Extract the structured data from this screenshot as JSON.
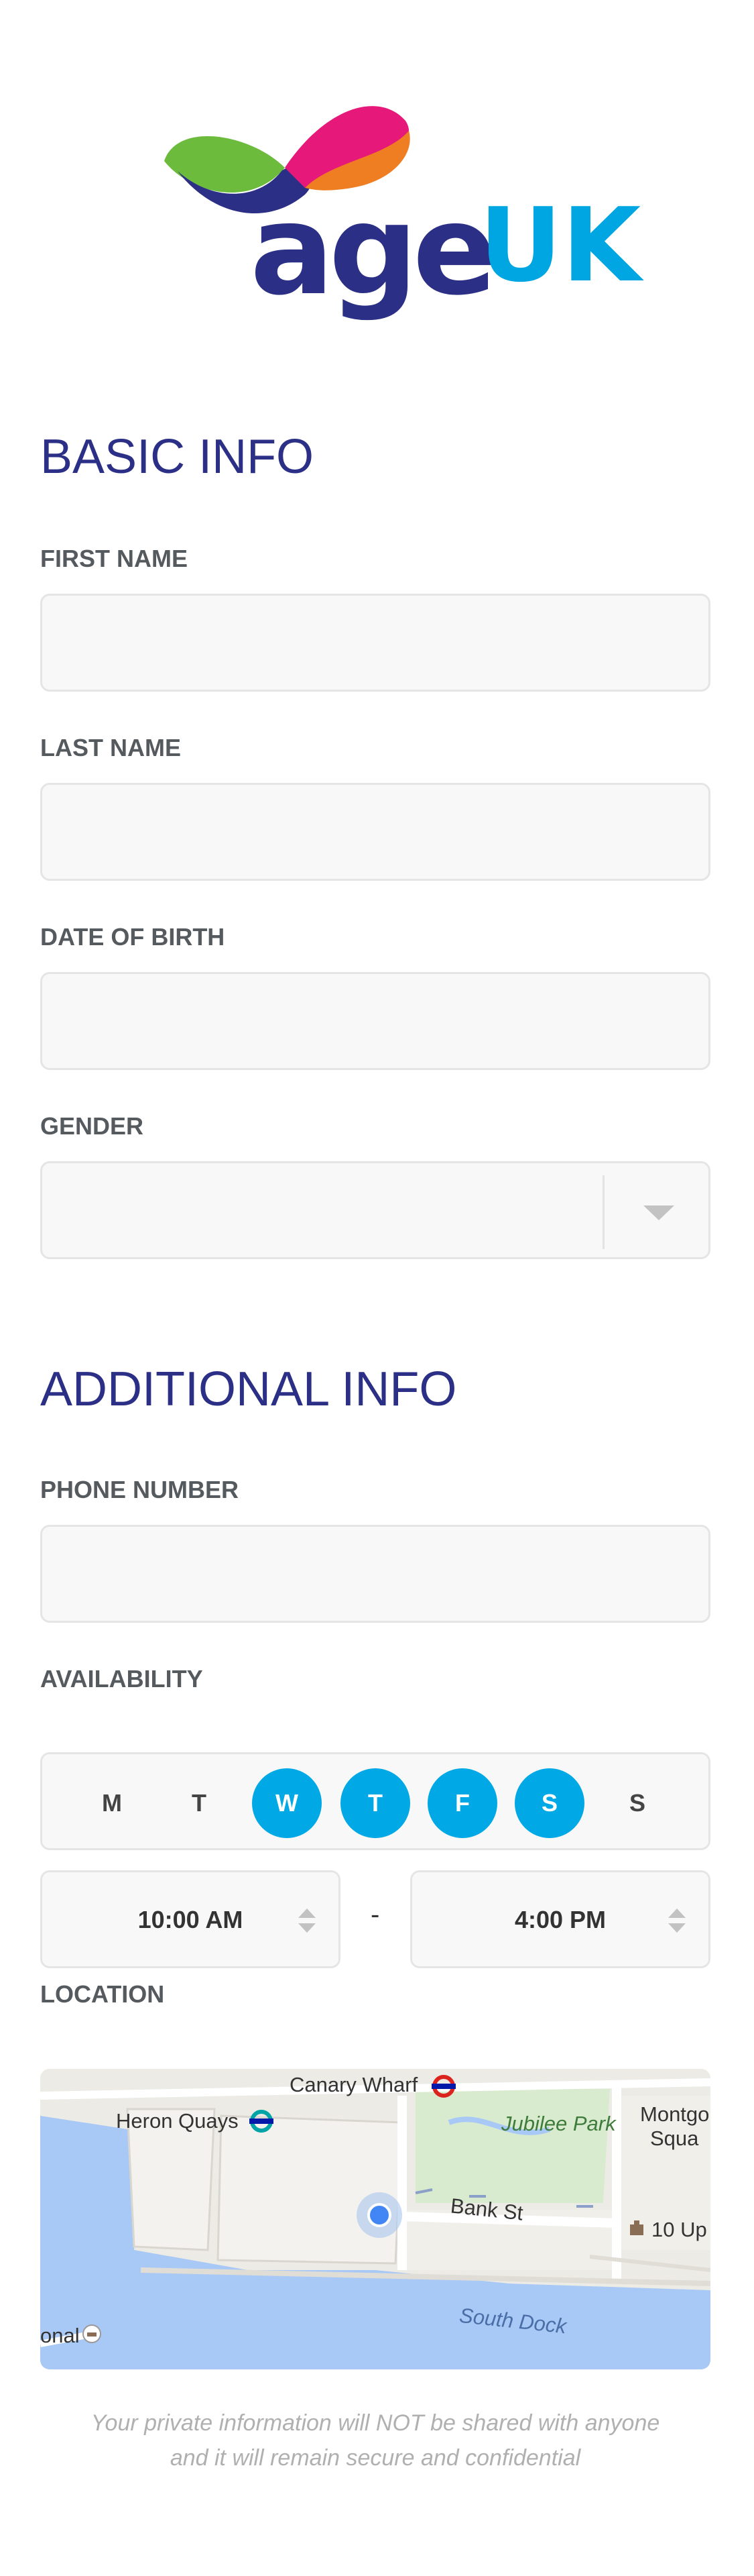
{
  "brand": {
    "name_part1": "age",
    "name_part2": "UK",
    "colors": {
      "navy": "#2b2f86",
      "blue": "#00a6e2",
      "pink": "#e6197a",
      "orange": "#ef7d22",
      "green": "#6cbb3c"
    }
  },
  "basic_info": {
    "title": "BASIC INFO",
    "first_name": {
      "label": "FIRST NAME",
      "value": "",
      "placeholder": ""
    },
    "last_name": {
      "label": "LAST NAME",
      "value": "",
      "placeholder": ""
    },
    "date_of_birth": {
      "label": "DATE OF BIRTH",
      "value": "",
      "placeholder": ""
    },
    "gender": {
      "label": "GENDER",
      "selected": ""
    }
  },
  "additional_info": {
    "title": "ADDITIONAL INFO",
    "phone_number": {
      "label": "PHONE NUMBER",
      "value": "",
      "placeholder": ""
    },
    "availability": {
      "label": "AVAILABILITY",
      "days": [
        {
          "label": "M",
          "selected": false
        },
        {
          "label": "T",
          "selected": false
        },
        {
          "label": "W",
          "selected": true
        },
        {
          "label": "T",
          "selected": true
        },
        {
          "label": "F",
          "selected": true
        },
        {
          "label": "S",
          "selected": true
        },
        {
          "label": "S",
          "selected": false
        }
      ],
      "start_time": "10:00 AM",
      "separator": "-",
      "end_time": "4:00 PM"
    },
    "location": {
      "label": "LOCATION",
      "map_labels": {
        "canary_wharf": "Canary Wharf",
        "heron_quays": "Heron Quays",
        "jubilee_park": "Jubilee Park",
        "montgomery_1": "Montgo",
        "montgomery_2": "Squa",
        "bank_st": "Bank St",
        "ten_up": "10 Up",
        "south_dock": "South Dock",
        "onal": "onal"
      }
    }
  },
  "privacy_note": {
    "line1": "Your private information will NOT be shared with anyone",
    "line2": "and it will remain secure and confidential"
  },
  "colors": {
    "accent": "#00a9e6",
    "heading": "#2b2f86",
    "label": "#555a5f",
    "field_bg": "#f8f8f8",
    "field_border": "#e5e5e5",
    "note": "#b0b0b0"
  }
}
